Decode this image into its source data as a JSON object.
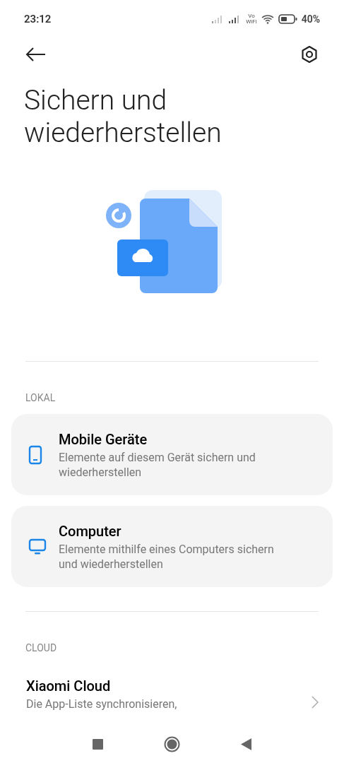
{
  "status_bar": {
    "time": "23:12",
    "vowifi": [
      "Vo",
      "WiFi"
    ],
    "battery": "40%"
  },
  "title": "Sichern und wiederherstellen",
  "sections": [
    {
      "header": "LOKAL",
      "kind": "cards",
      "items": [
        {
          "kind": "phone",
          "title": "Mobile Geräte",
          "subtitle": "Elemente auf diesem Gerät sichern und wiederherstellen"
        },
        {
          "kind": "monitor",
          "title": "Computer",
          "subtitle": "Elemente mithilfe eines Computers sichern und wiederherstellen"
        }
      ]
    },
    {
      "header": "CLOUD",
      "kind": "list",
      "items": [
        {
          "title": "Xiaomi Cloud",
          "subtitle": "Die App-Liste synchronisieren,"
        }
      ]
    }
  ]
}
